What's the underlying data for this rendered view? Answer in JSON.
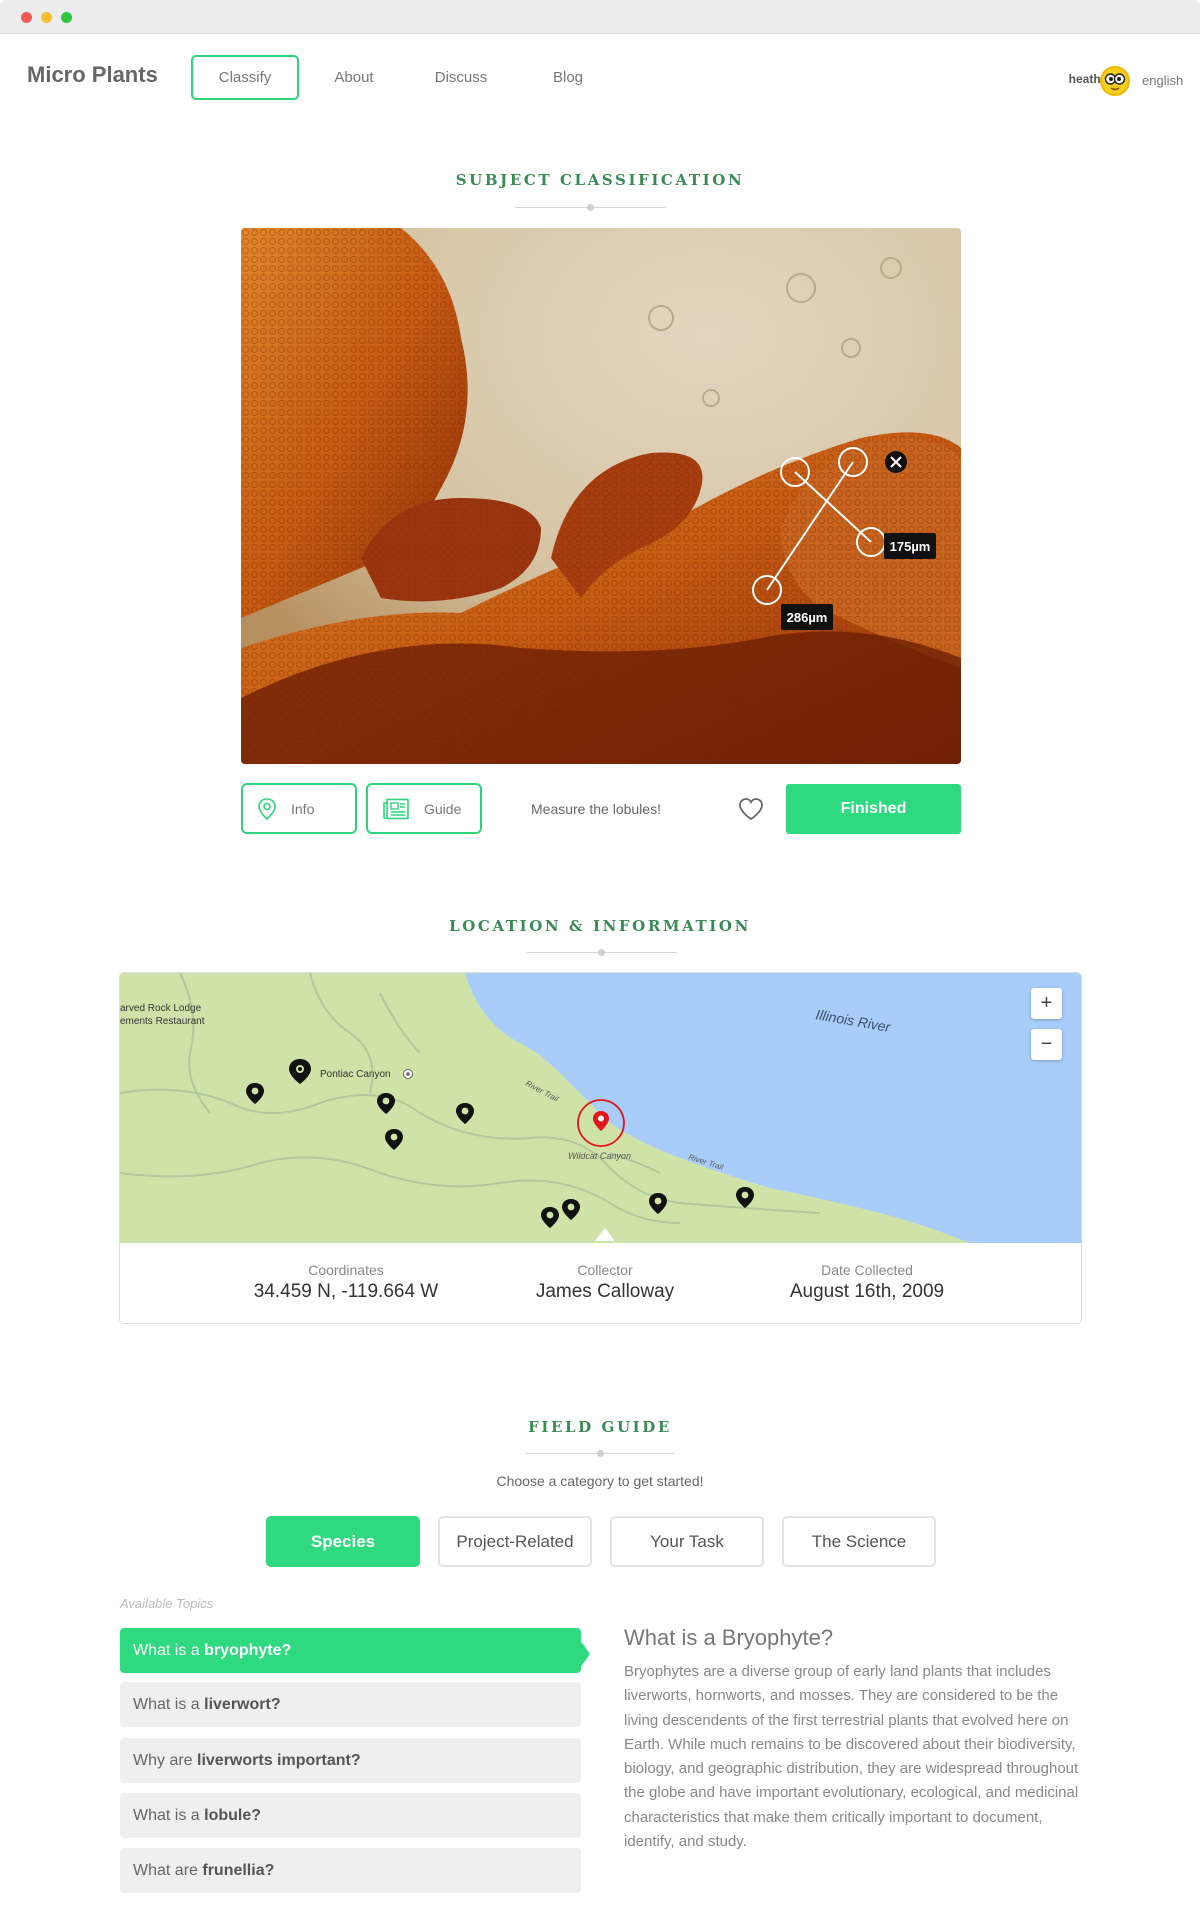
{
  "header": {
    "brand": "Micro Plants",
    "nav": [
      {
        "label": "Classify",
        "active": true
      },
      {
        "label": "About"
      },
      {
        "label": "Discuss"
      },
      {
        "label": "Blog"
      }
    ],
    "username": "heathvs",
    "language": "english"
  },
  "classification": {
    "section_title": "SUBJECT CLASSIFICATION",
    "measurements": [
      "175µm",
      "286µm"
    ],
    "info_label": "Info",
    "guide_label": "Guide",
    "prompt": "Measure the lobules!",
    "finished_label": "Finished"
  },
  "location": {
    "section_title": "LOCATION & INFORMATION",
    "map": {
      "labels": {
        "lodge_line1": "arved Rock Lodge",
        "lodge_line2": "ements Restaurant",
        "pontiac": "Pontiac Canyon",
        "river": "Illinois River",
        "trail1": "River Trail",
        "trail2": "River Trail",
        "wildcat": "Wildcat Canyon"
      },
      "zoom_in": "+",
      "zoom_out": "−"
    },
    "coordinates_label": "Coordinates",
    "coordinates_value": "34.459 N, -119.664 W",
    "collector_label": "Collector",
    "collector_value": "James Calloway",
    "date_label": "Date Collected",
    "date_value": "August 16th, 2009"
  },
  "field_guide": {
    "section_title": "FIELD GUIDE",
    "subtitle": "Choose a category to get started!",
    "categories": [
      {
        "label": "Species",
        "active": true
      },
      {
        "label": "Project-Related"
      },
      {
        "label": "Your Task"
      },
      {
        "label": "The Science"
      }
    ],
    "available_label": "Available Topics",
    "topics": [
      {
        "prefix": "What is a ",
        "term": "bryophyte?",
        "active": true
      },
      {
        "prefix": "What is a ",
        "term": "liverwort?"
      },
      {
        "prefix": "Why are ",
        "term": "liverworts important?"
      },
      {
        "prefix": "What is a ",
        "term": "lobule?"
      },
      {
        "prefix": "What are ",
        "term": "frunellia?"
      }
    ],
    "article_title": "What is a Bryophyte?",
    "article_body": "Bryophytes are a diverse group of early land plants that includes liverworts, hornworts, and mosses. They are considered to be the living descendents of the first terrestrial plants that evolved here on Earth. While much remains to be discovered about their biodiversity, biology, and geographic distribution, they are widespread throughout the globe and have important evolutionary, ecological, and medicinal characteristics that make them critically important to document, identify, and study."
  },
  "colors": {
    "accent": "#2fd980",
    "section_title": "#3a8a56",
    "water": "#a9cdfb",
    "land": "#cfe3a8",
    "selected_pin": "#e3161c"
  }
}
